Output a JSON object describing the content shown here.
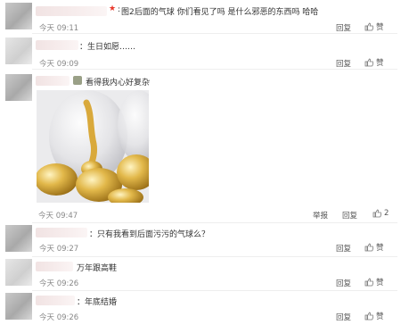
{
  "actions": {
    "reply": "回复",
    "like": "赞",
    "report": "举报"
  },
  "comments": [
    {
      "time": "今天 09:11",
      "prefix": ":",
      "text": "图2后面的气球 你们看见了吗 是什么邪恶的东西吗 哈哈"
    },
    {
      "time": "今天 09:09",
      "text": "：生日如愿……"
    },
    {
      "time": "今天 09:47",
      "text": "看得我内心好复杂",
      "like_count": "2",
      "photo_icon": "balloon-photo"
    },
    {
      "time": "今天 09:27",
      "text": "：只有我看到后面污污的气球么？"
    },
    {
      "time": "今天 09:26",
      "text": "万年跟高鞋"
    },
    {
      "time": "今天 09:26",
      "text": "：年底结婚"
    }
  ],
  "colors": {
    "accent_star": "#e8372b",
    "time_gray": "#888888",
    "separator": "#eeeeee"
  }
}
